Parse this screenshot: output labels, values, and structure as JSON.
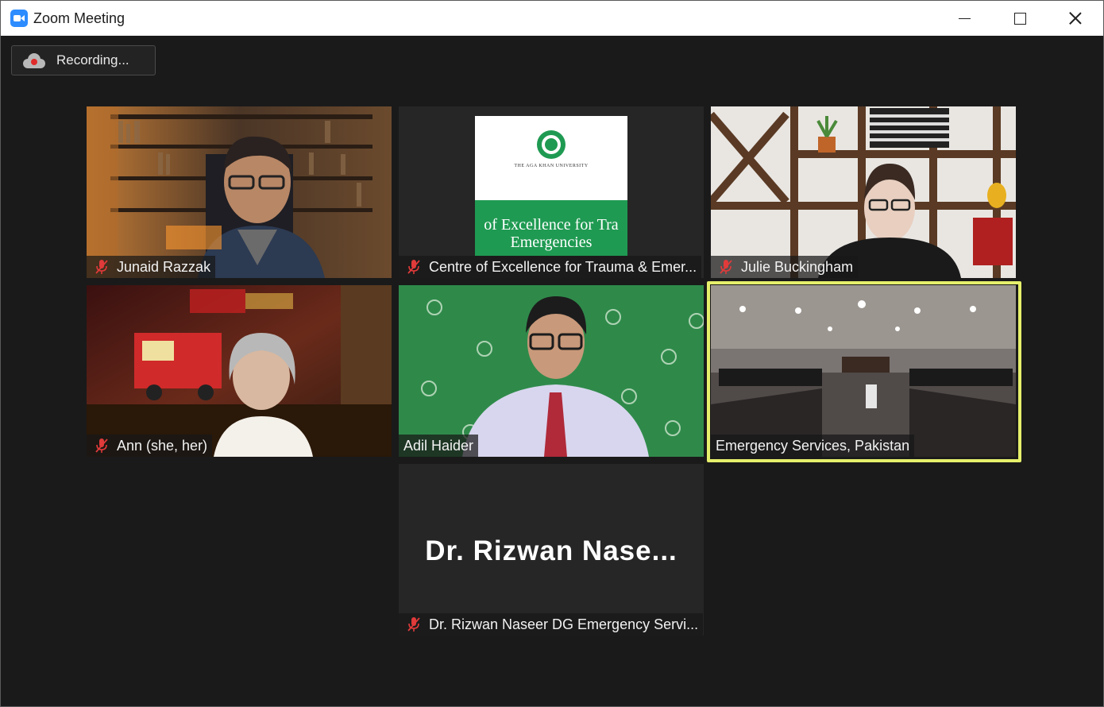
{
  "window": {
    "title": "Zoom Meeting",
    "app_icon": "zoom-camera-icon"
  },
  "recording": {
    "label": "Recording...",
    "icon": "cloud-recording-icon"
  },
  "colors": {
    "active_speaker_border": "#e6f06b",
    "mute_icon": "#e03a3a",
    "zoom_blue": "#2d8cff"
  },
  "participants": [
    {
      "name": "Junaid Razzak",
      "muted": true
    },
    {
      "name": "Centre of Excellence for Trauma & Emer...",
      "muted": true,
      "shared_slide": {
        "org": "THE AGA KHAN UNIVERSITY",
        "line1": "of Excellence for Tra",
        "line2": "Emergencies"
      }
    },
    {
      "name": "Julie Buckingham",
      "muted": true
    },
    {
      "name": "Ann (she, her)",
      "muted": true
    },
    {
      "name": "Adil Haider",
      "muted": false
    },
    {
      "name": "Emergency Services, Pakistan",
      "muted": false,
      "active_speaker": true
    },
    {
      "name": "Dr. Rizwan Naseer DG Emergency Servi...",
      "muted": true,
      "avatar_text": "Dr. Rizwan Nase..."
    }
  ]
}
